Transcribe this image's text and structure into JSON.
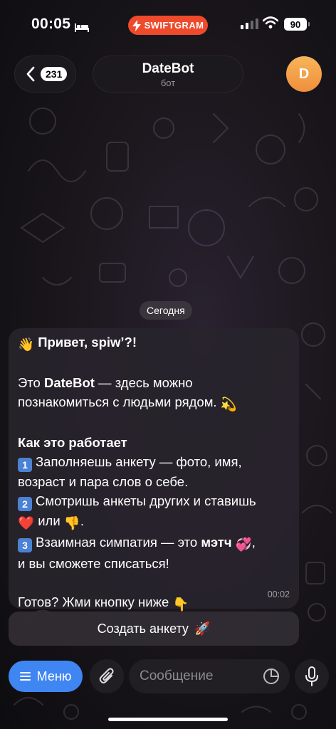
{
  "status_bar": {
    "time": "00:05",
    "swiftgram_label": "SWIFTGRAM",
    "battery": "90",
    "accent": "#ee4a2b"
  },
  "header": {
    "back_count": "231",
    "chat_title": "DateBot",
    "chat_subtitle": "бот",
    "avatar_letter": "D",
    "avatar_color": "#f3a04a"
  },
  "chat": {
    "date_label": "Сегодня",
    "message": {
      "greeting": "Привет, spiw’?!",
      "intro_prefix": "Это ",
      "intro_bold": "DateBot",
      "intro_rest": " — здесь можно",
      "intro_line2": "познакомиться с людьми рядом.",
      "how_title": "Как это работает",
      "step1_line1": "Заполняешь анкету — фото, имя,",
      "step1_line2": "возраст и пара слов о себе.",
      "step2_line1": "Смотришь анкеты других и ставишь",
      "step2_or": "или",
      "step2_end": ".",
      "step3_prefix": "Взаимная симпатия — это ",
      "step3_bold": "мэтч",
      "step3_comma": ",",
      "step3_line2": "и вы сможете списаться!",
      "cta": "Готов? Жми кнопку ниже",
      "time": "00:02",
      "keycaps": [
        "1",
        "2",
        "3"
      ]
    },
    "inline_button": {
      "label": "Создать анкету",
      "icon": "rocket-icon"
    }
  },
  "input_bar": {
    "menu_label": "Меню",
    "placeholder": "Сообщение",
    "menu_color": "#3f86f2"
  }
}
